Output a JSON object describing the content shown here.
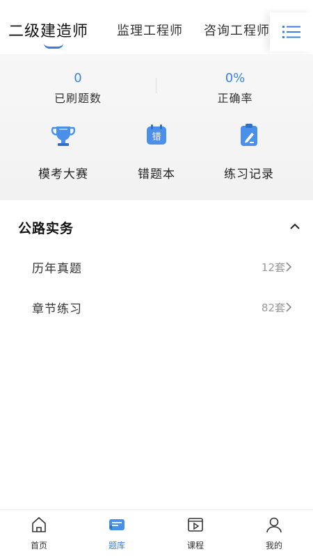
{
  "subject_tabs": [
    {
      "label": "二级建造师",
      "active": true
    },
    {
      "label": "监理工程师",
      "active": false
    },
    {
      "label": "咨询工程师",
      "active": false
    }
  ],
  "menu_icon": "list-menu-icon",
  "stats": {
    "done_count": "0",
    "done_label": "已刷题数",
    "accuracy": "0%",
    "accuracy_label": "正确率"
  },
  "features": [
    {
      "label": "模考大赛",
      "icon": "trophy-icon"
    },
    {
      "label": "错题本",
      "icon": "mistake-calendar-icon"
    },
    {
      "label": "练习记录",
      "icon": "clipboard-edit-icon"
    }
  ],
  "section": {
    "title": "公路实务",
    "expanded": true,
    "rows": [
      {
        "label": "历年真题",
        "count": "12套"
      },
      {
        "label": "章节练习",
        "count": "82套"
      }
    ]
  },
  "bottom_nav": [
    {
      "label": "首页",
      "icon": "home-icon",
      "active": false
    },
    {
      "label": "题库",
      "icon": "question-bank-icon",
      "active": true
    },
    {
      "label": "课程",
      "icon": "course-video-icon",
      "active": false
    },
    {
      "label": "我的",
      "icon": "profile-icon",
      "active": false
    }
  ],
  "colors": {
    "accent": "#3a82e2",
    "text": "#222222",
    "muted": "#999999"
  }
}
